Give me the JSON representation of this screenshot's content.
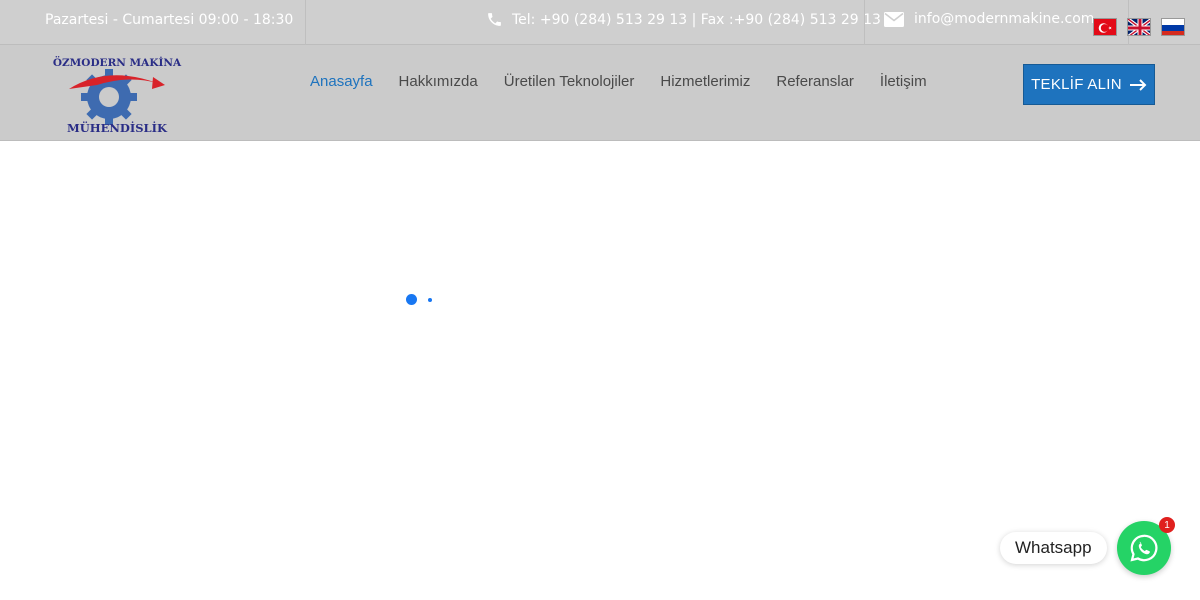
{
  "topbar": {
    "hours": "Pazartesi - Cumartesi 09:00 - 18:30",
    "phone": "Tel: +90 (284) 513 29 13 | Fax :+90 (284) 513 29 13",
    "email": "info@modernmakine.com",
    "icons": {
      "phone": "phone-icon",
      "email": "envelope-icon"
    },
    "languages": [
      {
        "code": "tr",
        "icon": "flag-turkey-icon"
      },
      {
        "code": "en",
        "icon": "flag-uk-icon"
      },
      {
        "code": "ru",
        "icon": "flag-russia-icon"
      }
    ]
  },
  "logo": {
    "top_text": "ÖZMODERN MAKİNA",
    "bottom_text": "MÜHENDİSLİK"
  },
  "nav": {
    "items": [
      {
        "label": "Anasayfa",
        "active": true
      },
      {
        "label": "Hakkımızda",
        "active": false
      },
      {
        "label": "Üretilen Teknolojiler",
        "active": false
      },
      {
        "label": "Hizmetlerimiz",
        "active": false
      },
      {
        "label": "Referanslar",
        "active": false
      },
      {
        "label": "İletişim",
        "active": false
      }
    ]
  },
  "cta": {
    "label": "TEKLİF ALIN",
    "icon": "arrow-right-icon"
  },
  "whatsapp": {
    "label": "Whatsapp",
    "badge": "1",
    "icon": "whatsapp-icon"
  },
  "colors": {
    "accent": "#1e73be",
    "topbar_bg": "#cfcfcf",
    "header_bg": "#cbcbcb",
    "whatsapp": "#25d366",
    "badge": "#e0201e",
    "loader": "#1877f2"
  }
}
